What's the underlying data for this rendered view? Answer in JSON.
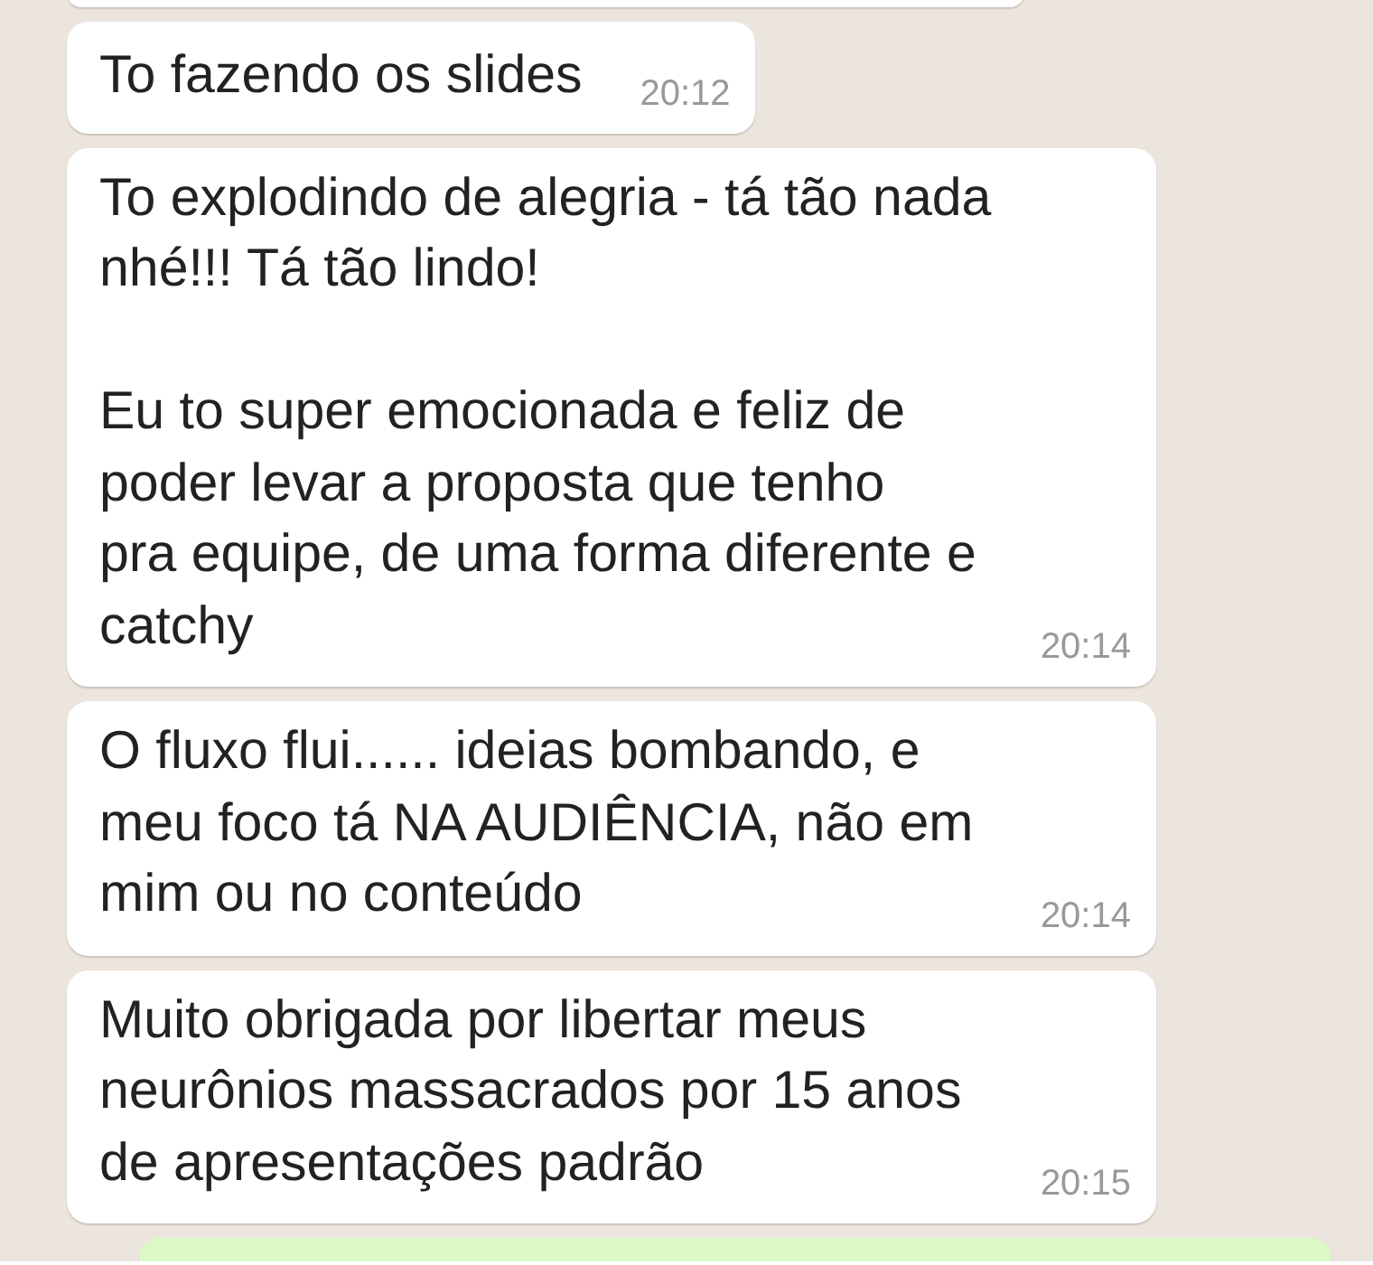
{
  "messages": [
    {
      "text": "To fazendo os slides",
      "time": "20:12"
    },
    {
      "text": "To explodindo de alegria - tá tão nada\nnhé!!! Tá tão lindo!\n\nEu to super emocionada e feliz de\npoder levar a proposta que tenho\npra equipe, de uma forma diferente e\ncatchy",
      "time": "20:14"
    },
    {
      "text": "O fluxo flui...... ideias bombando, e\nmeu foco tá NA AUDIÊNCIA, não em\nmim ou no conteúdo",
      "time": "20:14"
    },
    {
      "text": "Muito obrigada por libertar meus\nneurônios massacrados por 15 anos\nde apresentações padrão",
      "time": "20:15"
    }
  ]
}
